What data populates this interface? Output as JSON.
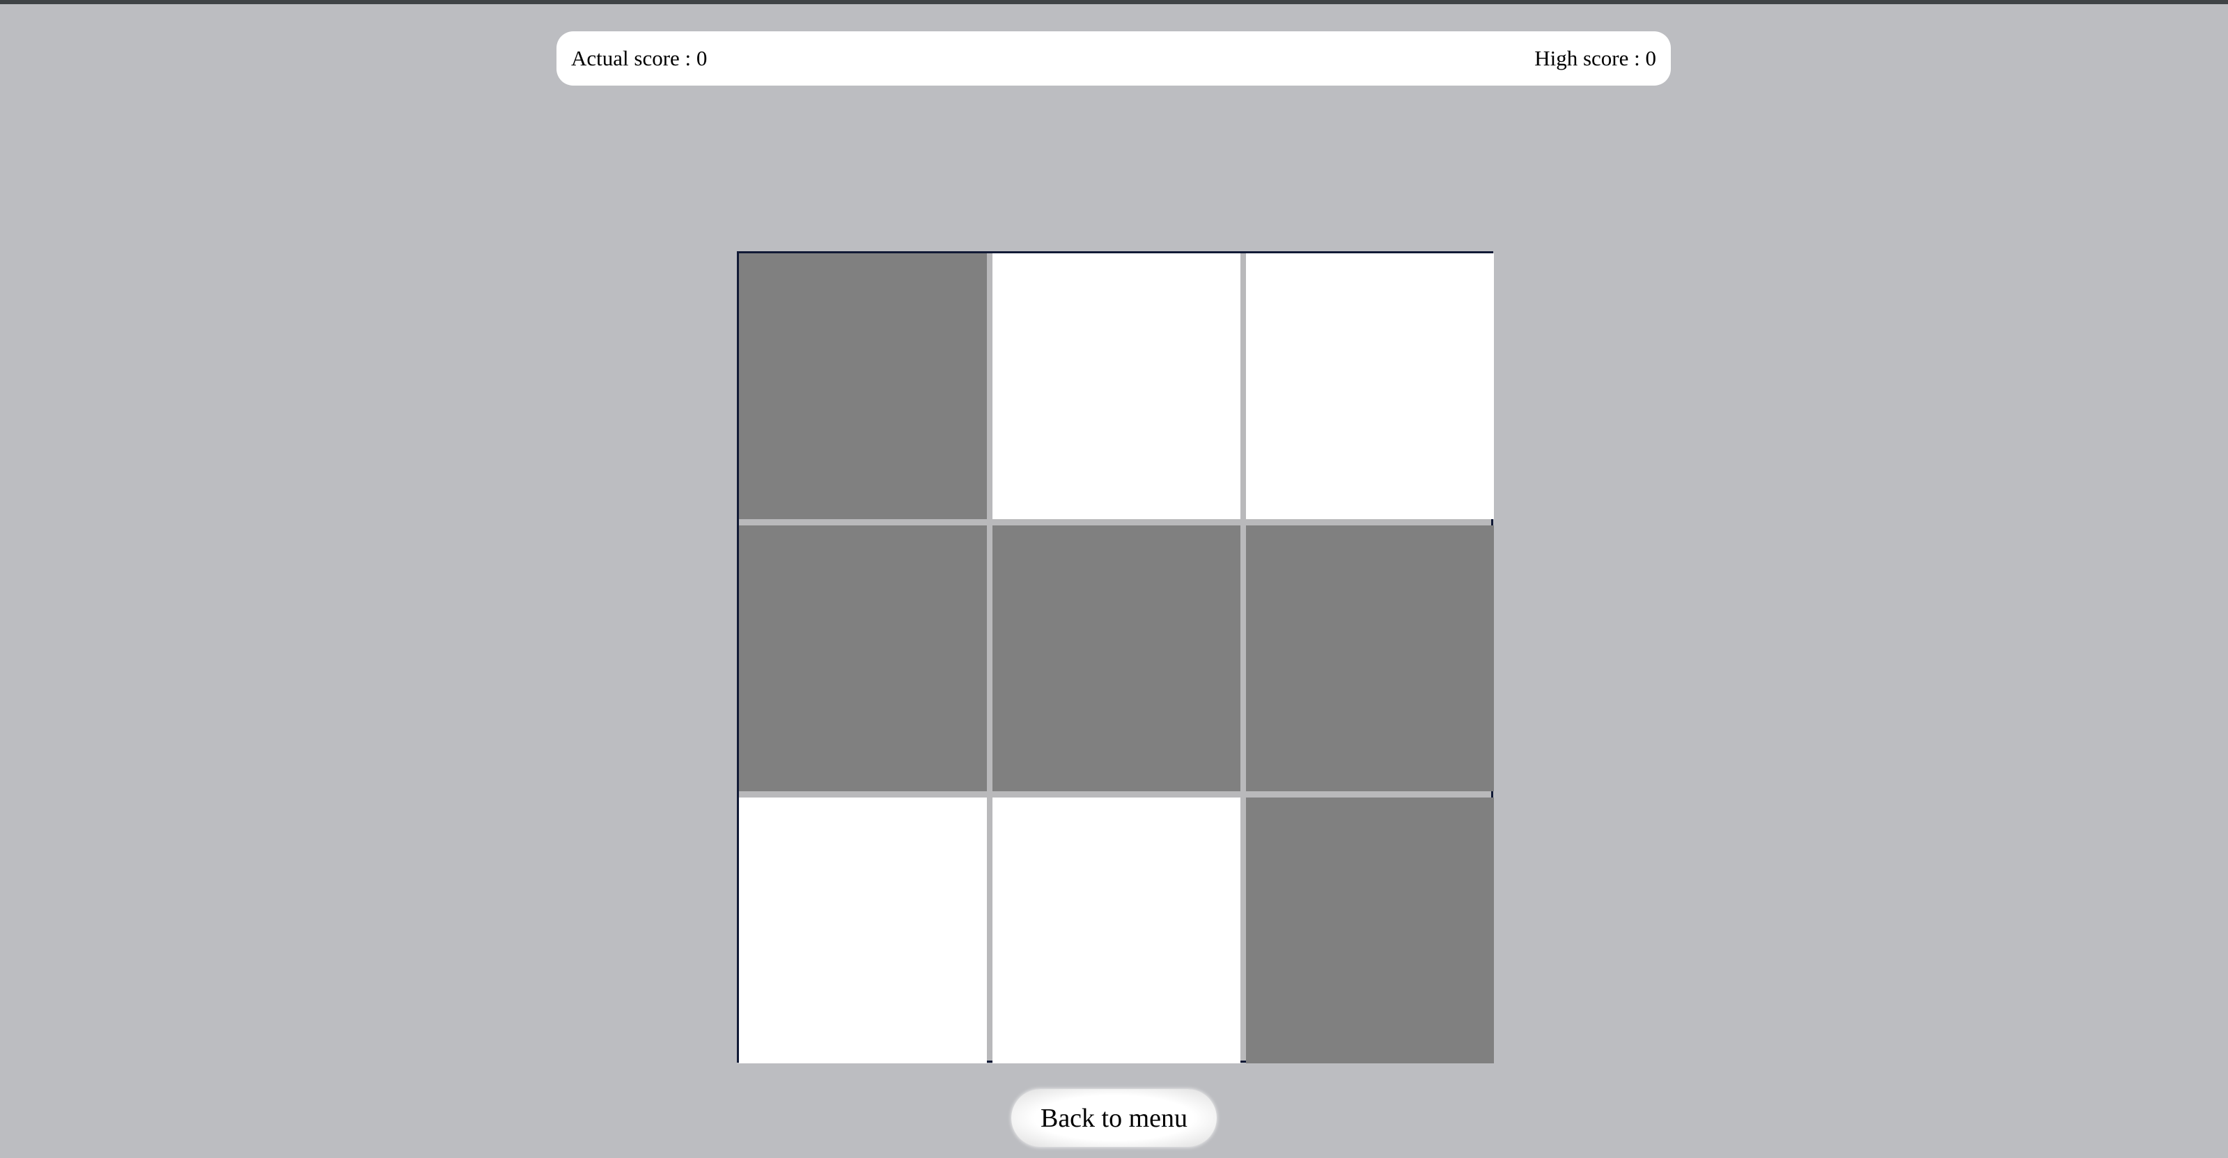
{
  "scores": {
    "actual_label": "Actual score : 0",
    "high_label": "High score : 0"
  },
  "board": {
    "rows": 3,
    "cols": 3,
    "cells": [
      [
        "dark",
        "light",
        "light"
      ],
      [
        "dark",
        "dark",
        "dark"
      ],
      [
        "light",
        "light",
        "dark"
      ]
    ],
    "colors": {
      "dark": "#808080",
      "light": "#ffffff",
      "background": "#bcbdc1",
      "border": "#111a36"
    }
  },
  "menu_button": {
    "label": "Back to menu"
  }
}
